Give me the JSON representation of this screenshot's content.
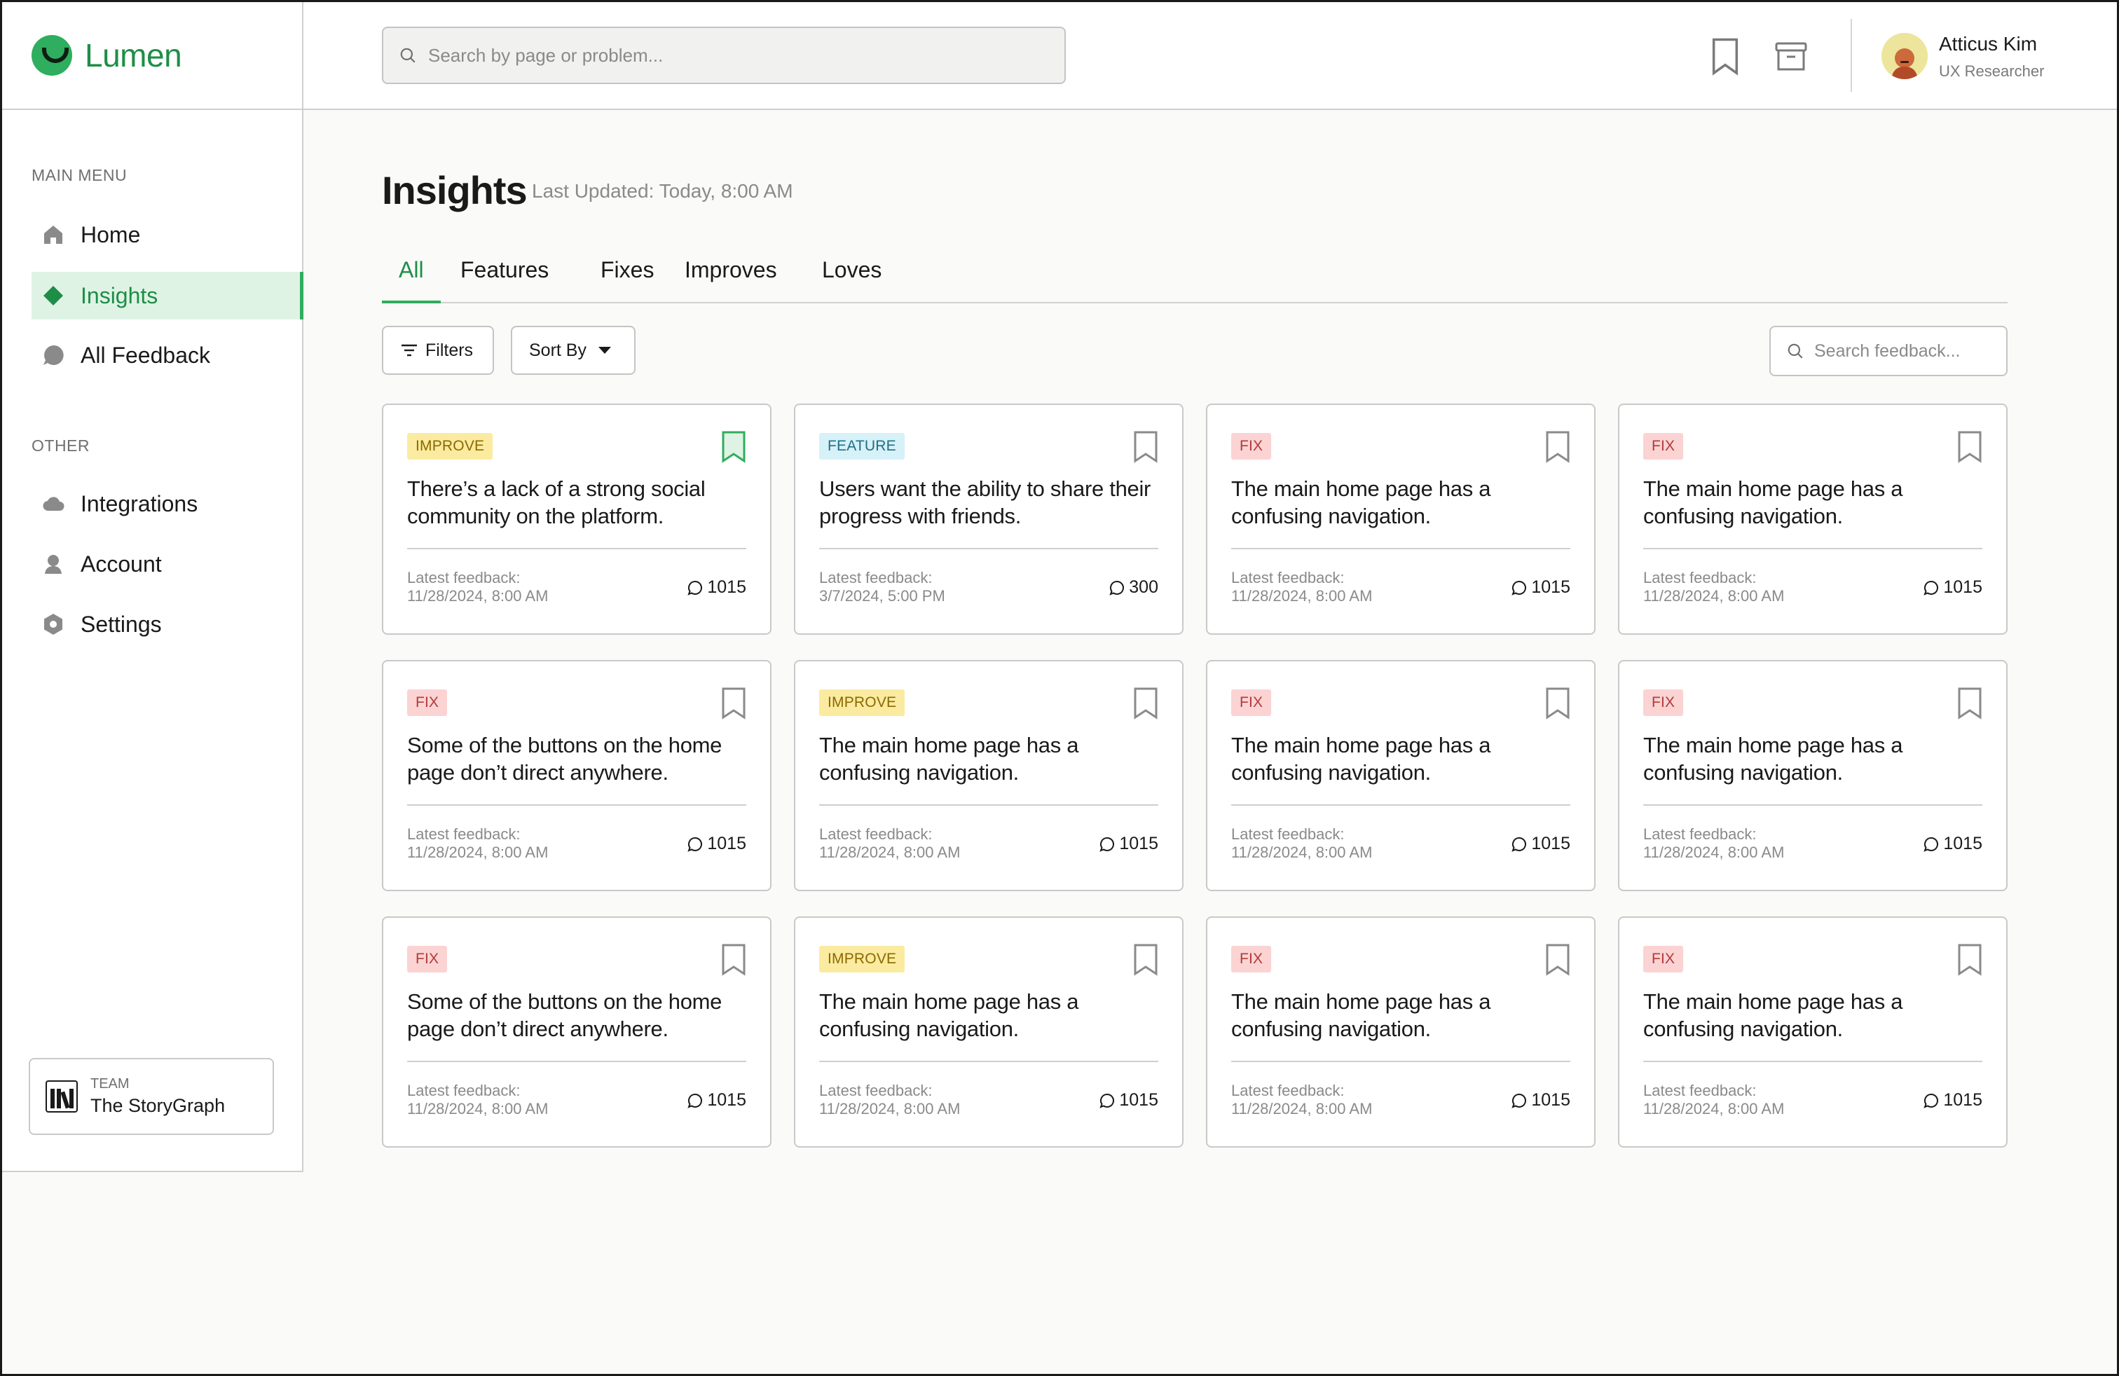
{
  "app": {
    "name": "Lumen"
  },
  "header": {
    "search_placeholder": "Search by page or problem...",
    "user": {
      "name": "Atticus Kim",
      "role": "UX Researcher"
    }
  },
  "sidebar": {
    "main_label": "MAIN MENU",
    "main_items": [
      {
        "label": "Home",
        "icon": "home-icon"
      },
      {
        "label": "Insights",
        "icon": "diamond-icon",
        "active": true
      },
      {
        "label": "All Feedback",
        "icon": "chat-bubble-icon"
      }
    ],
    "other_label": "OTHER",
    "other_items": [
      {
        "label": "Integrations",
        "icon": "cloud-icon"
      },
      {
        "label": "Account",
        "icon": "user-icon"
      },
      {
        "label": "Settings",
        "icon": "gear-icon"
      }
    ],
    "team": {
      "label": "TEAM",
      "name": "The StoryGraph"
    }
  },
  "main": {
    "title": "Insights",
    "last_updated": "Last Updated: Today, 8:00 AM",
    "tabs": [
      "All",
      "Features",
      "Fixes",
      "Improves",
      "Loves"
    ],
    "active_tab": "All",
    "filters_label": "Filters",
    "sort_label": "Sort By",
    "feedback_search_placeholder": "Search feedback...",
    "cards": [
      {
        "tag": "IMPROVE",
        "type": "improve",
        "bookmarked": true,
        "title": "There’s a lack of a strong social community on the platform.",
        "meta_label": "Latest feedback:",
        "date": "11/28/2024, 8:00 AM",
        "count": "1015"
      },
      {
        "tag": "FEATURE",
        "type": "feature",
        "bookmarked": false,
        "title": "Users want the ability to share their progress with friends.",
        "meta_label": "Latest feedback:",
        "date": "3/7/2024, 5:00 PM",
        "count": "300"
      },
      {
        "tag": "FIX",
        "type": "fix",
        "bookmarked": false,
        "title": "The main home page has a confusing navigation.",
        "meta_label": "Latest feedback:",
        "date": "11/28/2024, 8:00 AM",
        "count": "1015"
      },
      {
        "tag": "FIX",
        "type": "fix",
        "bookmarked": false,
        "title": "The main home page has a confusing navigation.",
        "meta_label": "Latest feedback:",
        "date": "11/28/2024, 8:00 AM",
        "count": "1015"
      },
      {
        "tag": "FIX",
        "type": "fix",
        "bookmarked": false,
        "title": "Some of the buttons on the home page don’t direct anywhere.",
        "meta_label": "Latest feedback:",
        "date": "11/28/2024, 8:00 AM",
        "count": "1015"
      },
      {
        "tag": "IMPROVE",
        "type": "improve",
        "bookmarked": false,
        "title": "The main home page has a confusing navigation.",
        "meta_label": "Latest feedback:",
        "date": "11/28/2024, 8:00 AM",
        "count": "1015"
      },
      {
        "tag": "FIX",
        "type": "fix",
        "bookmarked": false,
        "title": "The main home page has a confusing navigation.",
        "meta_label": "Latest feedback:",
        "date": "11/28/2024, 8:00 AM",
        "count": "1015"
      },
      {
        "tag": "FIX",
        "type": "fix",
        "bookmarked": false,
        "title": "The main home page has a confusing navigation.",
        "meta_label": "Latest feedback:",
        "date": "11/28/2024, 8:00 AM",
        "count": "1015"
      },
      {
        "tag": "FIX",
        "type": "fix",
        "bookmarked": false,
        "title": "Some of the buttons on the home page don’t direct anywhere.",
        "meta_label": "Latest feedback:",
        "date": "11/28/2024, 8:00 AM",
        "count": "1015"
      },
      {
        "tag": "IMPROVE",
        "type": "improve",
        "bookmarked": false,
        "title": "The main home page has a confusing navigation.",
        "meta_label": "Latest feedback:",
        "date": "11/28/2024, 8:00 AM",
        "count": "1015"
      },
      {
        "tag": "FIX",
        "type": "fix",
        "bookmarked": false,
        "title": "The main home page has a confusing navigation.",
        "meta_label": "Latest feedback:",
        "date": "11/28/2024, 8:00 AM",
        "count": "1015"
      },
      {
        "tag": "FIX",
        "type": "fix",
        "bookmarked": false,
        "title": "The main home page has a confusing navigation.",
        "meta_label": "Latest feedback:",
        "date": "11/28/2024, 8:00 AM",
        "count": "1015"
      }
    ]
  },
  "colors": {
    "accent": "#2eae5e",
    "accent_text": "#1e8e47",
    "active_bg": "#dff3e5",
    "improve_bg": "#fbeba0",
    "feature_bg": "#d6f1f8",
    "fix_bg": "#fbd3d3"
  }
}
